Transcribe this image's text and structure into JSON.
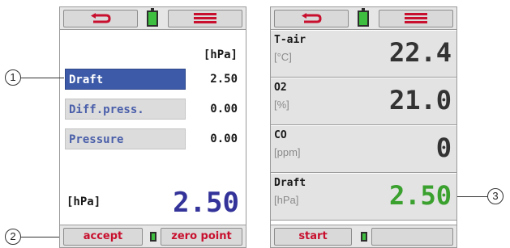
{
  "left_screen": {
    "unit_header": "[hPa]",
    "rows": [
      {
        "label": "Draft",
        "value": "2.50",
        "selected": true
      },
      {
        "label": "Diff.press.",
        "value": "0.00",
        "selected": false
      },
      {
        "label": "Pressure",
        "value": "0.00",
        "selected": false
      }
    ],
    "big_unit": "[hPa]",
    "big_value": "2.50",
    "accept_label": "accept",
    "zero_point_label": "zero point"
  },
  "right_screen": {
    "cells": [
      {
        "name": "T-air",
        "unit": "[°C]",
        "value": "22.4"
      },
      {
        "name": "O2",
        "unit": "[%]",
        "value": "21.0"
      },
      {
        "name": "CO",
        "unit": "[ppm]",
        "value": "0"
      },
      {
        "name": "Draft",
        "unit": "[hPa]",
        "value": "2.50"
      }
    ],
    "start_label": "start"
  },
  "callouts": {
    "one": "1",
    "two": "2",
    "three": "3"
  },
  "colors": {
    "accent_red": "#c8102e",
    "selected_blue": "#3c5aa8",
    "value_purple": "#33339a",
    "value_green": "#3aa02e",
    "battery_green": "#3fbf3f"
  },
  "icons": {
    "back": "back-arrow-icon",
    "menu": "hamburger-menu-icon",
    "battery": "battery-icon"
  }
}
